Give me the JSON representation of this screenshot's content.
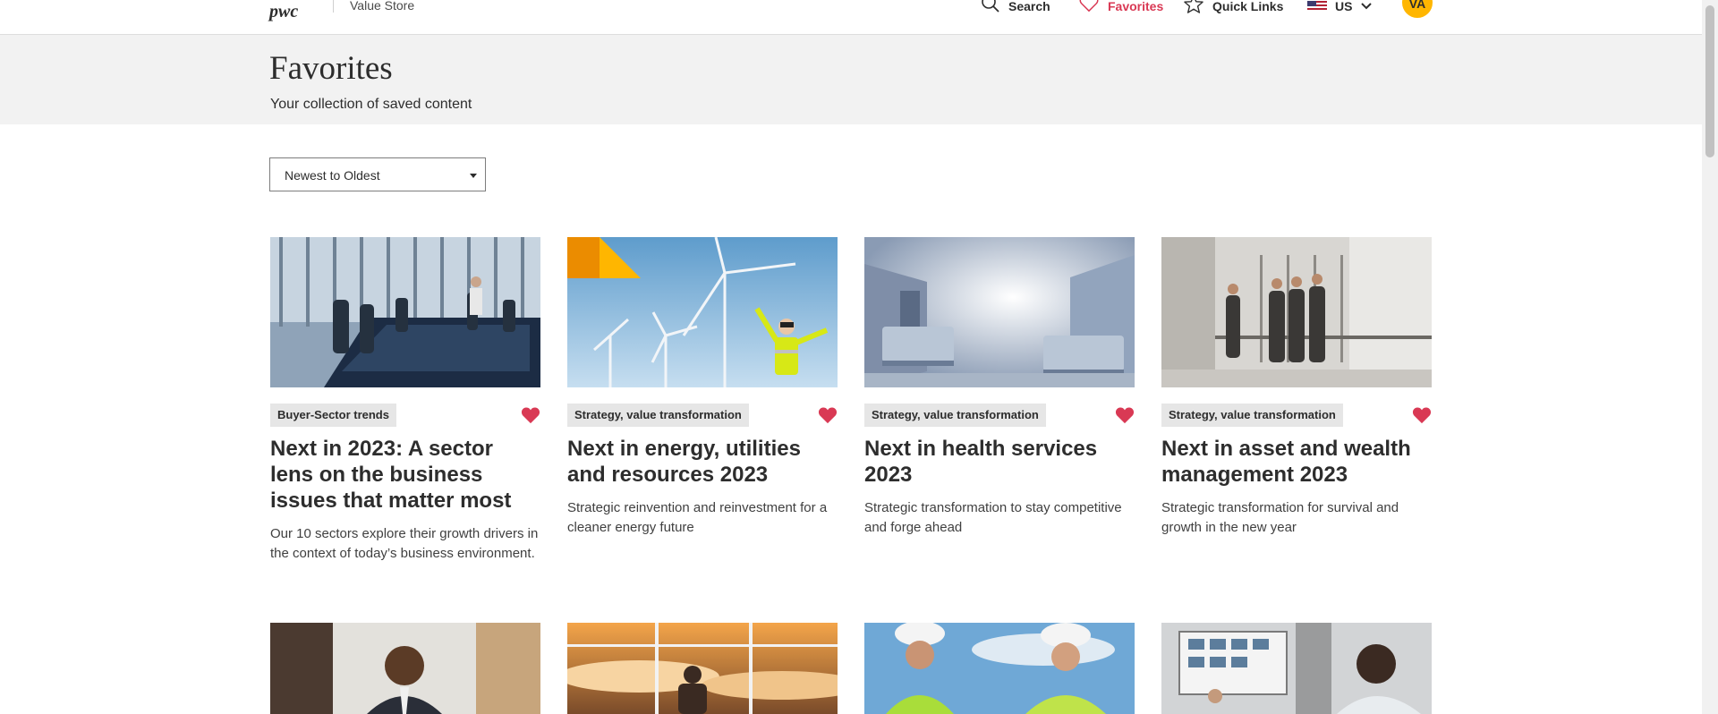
{
  "header": {
    "logo_text": "pwc",
    "store_name": "Value Store",
    "nav": {
      "search": "Search",
      "favorites": "Favorites",
      "quick_links": "Quick Links",
      "region": "US"
    },
    "avatar_initials": "VA",
    "accent_color": "#d93954"
  },
  "page": {
    "title": "Favorites",
    "subtitle": "Your collection of saved content"
  },
  "sort": {
    "selected": "Newest to Oldest"
  },
  "cards": [
    {
      "tag": "Buyer-Sector trends",
      "title": "Next in 2023: A sector lens on the business issues that matter most",
      "description": "Our 10 sectors explore their growth drivers in the context of today’s business environment.",
      "favorited": true
    },
    {
      "tag": "Strategy, value transformation",
      "title": "Next in energy, utilities and resources 2023",
      "description": "Strategic reinvention and reinvestment for a cleaner energy future",
      "favorited": true
    },
    {
      "tag": "Strategy, value transformation",
      "title": "Next in health services 2023",
      "description": "Strategic transformation to stay competitive and forge ahead",
      "favorited": true
    },
    {
      "tag": "Strategy, value transformation",
      "title": "Next in asset and wealth management 2023",
      "description": "Strategic transformation for survival and growth in the new year",
      "favorited": true
    }
  ]
}
